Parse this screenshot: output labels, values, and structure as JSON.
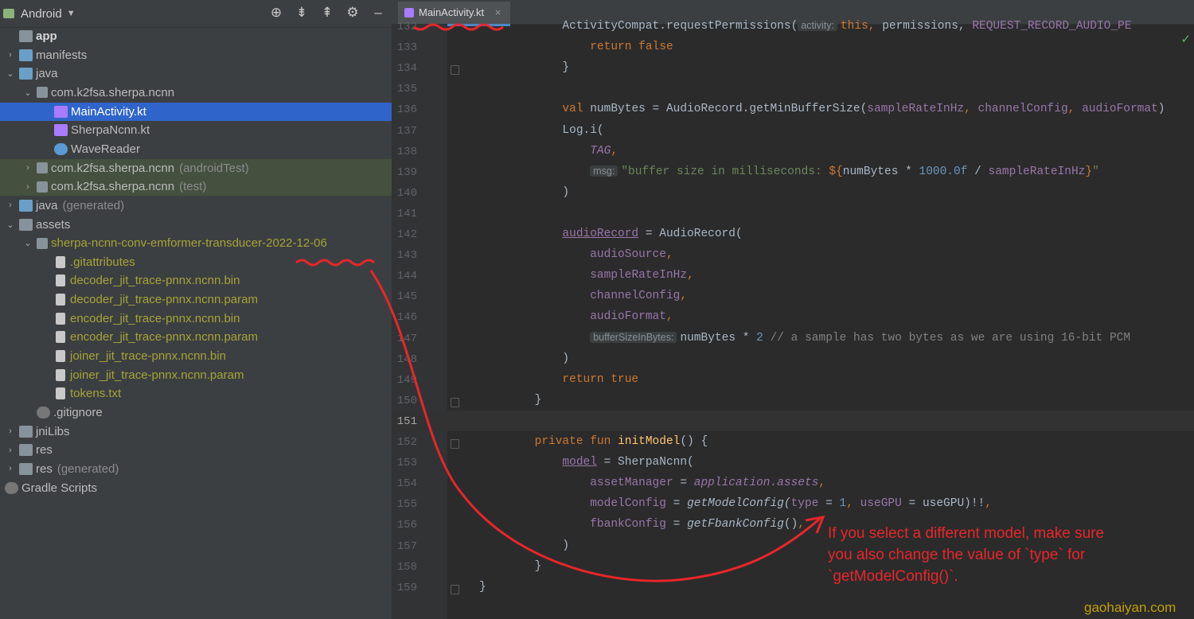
{
  "project": {
    "title": "Android",
    "icons": [
      "target-icon",
      "expand-icon",
      "collapse-icon",
      "gear-icon"
    ],
    "rows": [
      {
        "label": "app",
        "extra": "",
        "kind": "app",
        "indent": 0,
        "arrow": "",
        "style": ""
      },
      {
        "label": "manifests",
        "extra": "",
        "kind": "folder-blue",
        "indent": 0,
        "arrow": "›",
        "style": ""
      },
      {
        "label": "java",
        "extra": "",
        "kind": "folder-blue",
        "indent": 0,
        "arrow": "⌄",
        "style": ""
      },
      {
        "label": "com.k2fsa.sherpa.ncnn",
        "extra": "",
        "kind": "pkg",
        "indent": 1,
        "arrow": "⌄",
        "style": ""
      },
      {
        "label": "MainActivity.kt",
        "extra": "",
        "kind": "kt",
        "indent": 2,
        "arrow": "",
        "style": "sel"
      },
      {
        "label": "SherpaNcnn.kt",
        "extra": "",
        "kind": "kt",
        "indent": 2,
        "arrow": "",
        "style": ""
      },
      {
        "label": "WaveReader",
        "extra": "",
        "kind": "wave",
        "indent": 2,
        "arrow": "",
        "style": ""
      },
      {
        "label": "com.k2fsa.sherpa.ncnn",
        "extra": "(androidTest)",
        "kind": "pkg",
        "indent": 1,
        "arrow": "›",
        "style": "test"
      },
      {
        "label": "com.k2fsa.sherpa.ncnn",
        "extra": "(test)",
        "kind": "pkg",
        "indent": 1,
        "arrow": "›",
        "style": "test"
      },
      {
        "label": "java",
        "extra": "(generated)",
        "kind": "folder-blue",
        "indent": 0,
        "arrow": "›",
        "style": ""
      },
      {
        "label": "assets",
        "extra": "",
        "kind": "folder",
        "indent": 0,
        "arrow": "⌄",
        "style": ""
      },
      {
        "label": "sherpa-ncnn-conv-emformer-transducer-2022-12-06",
        "extra": "",
        "kind": "pkg",
        "indent": 1,
        "arrow": "⌄",
        "style": "olive"
      },
      {
        "label": ".gitattributes",
        "extra": "",
        "kind": "file",
        "indent": 2,
        "arrow": "",
        "style": "olive"
      },
      {
        "label": "decoder_jit_trace-pnnx.ncnn.bin",
        "extra": "",
        "kind": "file",
        "indent": 2,
        "arrow": "",
        "style": "olive"
      },
      {
        "label": "decoder_jit_trace-pnnx.ncnn.param",
        "extra": "",
        "kind": "file",
        "indent": 2,
        "arrow": "",
        "style": "olive"
      },
      {
        "label": "encoder_jit_trace-pnnx.ncnn.bin",
        "extra": "",
        "kind": "file",
        "indent": 2,
        "arrow": "",
        "style": "olive"
      },
      {
        "label": "encoder_jit_trace-pnnx.ncnn.param",
        "extra": "",
        "kind": "file",
        "indent": 2,
        "arrow": "",
        "style": "olive"
      },
      {
        "label": "joiner_jit_trace-pnnx.ncnn.bin",
        "extra": "",
        "kind": "file",
        "indent": 2,
        "arrow": "",
        "style": "olive"
      },
      {
        "label": "joiner_jit_trace-pnnx.ncnn.param",
        "extra": "",
        "kind": "file",
        "indent": 2,
        "arrow": "",
        "style": "olive"
      },
      {
        "label": "tokens.txt",
        "extra": "",
        "kind": "file",
        "indent": 2,
        "arrow": "",
        "style": "olive"
      },
      {
        "label": ".gitignore",
        "extra": "",
        "kind": "gear",
        "indent": 1,
        "arrow": "",
        "style": ""
      },
      {
        "label": "jniLibs",
        "extra": "",
        "kind": "folder",
        "indent": 0,
        "arrow": "›",
        "style": ""
      },
      {
        "label": "res",
        "extra": "",
        "kind": "folder",
        "indent": 0,
        "arrow": "›",
        "style": ""
      },
      {
        "label": "res",
        "extra": "(generated)",
        "kind": "folder",
        "indent": 0,
        "arrow": "›",
        "style": ""
      },
      {
        "label": "Gradle Scripts",
        "extra": "",
        "kind": "gradle",
        "indent": -1,
        "arrow": "",
        "style": ""
      }
    ]
  },
  "editor": {
    "tab_label": "MainActivity.kt",
    "tab_close": "×",
    "current_line": "151",
    "lines": [
      {
        "n": "132",
        "segs": [
          [
            "pad",
            "            "
          ],
          [
            "par",
            "ActivityCompat.requestPermissions("
          ],
          [
            "hint",
            "activity:"
          ],
          [
            "kw",
            "this, "
          ],
          [
            "par",
            "permissions, "
          ],
          [
            "prop",
            "REQUEST_RECORD_AUDIO_PE"
          ]
        ]
      },
      {
        "n": "133",
        "segs": [
          [
            "pad",
            "                "
          ],
          [
            "kw",
            "return false"
          ]
        ]
      },
      {
        "n": "134",
        "segs": [
          [
            "pad",
            "            "
          ],
          [
            "par",
            "}"
          ]
        ]
      },
      {
        "n": "135",
        "segs": []
      },
      {
        "n": "136",
        "segs": [
          [
            "pad",
            "            "
          ],
          [
            "kw",
            "val "
          ],
          [
            "par",
            "numBytes = AudioRecord.getMinBufferSize("
          ],
          [
            "prop",
            "sampleRateInHz"
          ],
          [
            "kw",
            ", "
          ],
          [
            "prop",
            "channelConfig"
          ],
          [
            "kw",
            ", "
          ],
          [
            "prop",
            "audioFormat"
          ],
          [
            "par",
            ")"
          ]
        ]
      },
      {
        "n": "137",
        "segs": [
          [
            "pad",
            "            "
          ],
          [
            "par",
            "Log.i("
          ]
        ]
      },
      {
        "n": "138",
        "segs": [
          [
            "pad",
            "                "
          ],
          [
            "propi",
            "TAG"
          ],
          [
            "kw",
            ","
          ]
        ]
      },
      {
        "n": "139",
        "segs": [
          [
            "pad",
            "                "
          ],
          [
            "hint",
            "msg:"
          ],
          [
            "str",
            "\"buffer size in milliseconds: "
          ],
          [
            "kw",
            "${"
          ],
          [
            "par",
            "numBytes * "
          ],
          [
            "num",
            "1000.0f"
          ],
          [
            "par",
            " / "
          ],
          [
            "prop",
            "sampleRateInHz"
          ],
          [
            "kw",
            "}"
          ],
          [
            "str",
            "\""
          ]
        ]
      },
      {
        "n": "140",
        "segs": [
          [
            "pad",
            "            "
          ],
          [
            "par",
            ")"
          ]
        ]
      },
      {
        "n": "141",
        "segs": []
      },
      {
        "n": "142",
        "segs": [
          [
            "pad",
            "            "
          ],
          [
            "propu",
            "audioRecord"
          ],
          [
            "par",
            " = AudioRecord("
          ]
        ]
      },
      {
        "n": "143",
        "segs": [
          [
            "pad",
            "                "
          ],
          [
            "prop",
            "audioSource"
          ],
          [
            "kw",
            ","
          ]
        ]
      },
      {
        "n": "144",
        "segs": [
          [
            "pad",
            "                "
          ],
          [
            "prop",
            "sampleRateInHz"
          ],
          [
            "kw",
            ","
          ]
        ]
      },
      {
        "n": "145",
        "segs": [
          [
            "pad",
            "                "
          ],
          [
            "prop",
            "channelConfig"
          ],
          [
            "kw",
            ","
          ]
        ]
      },
      {
        "n": "146",
        "segs": [
          [
            "pad",
            "                "
          ],
          [
            "prop",
            "audioFormat"
          ],
          [
            "kw",
            ","
          ]
        ]
      },
      {
        "n": "147",
        "segs": [
          [
            "pad",
            "                "
          ],
          [
            "hint",
            "bufferSizeInBytes:"
          ],
          [
            "par",
            "numBytes * "
          ],
          [
            "num",
            "2"
          ],
          [
            "cm",
            " // a sample has two bytes as we are using 16-bit PCM"
          ]
        ]
      },
      {
        "n": "148",
        "segs": [
          [
            "pad",
            "            "
          ],
          [
            "par",
            ")"
          ]
        ]
      },
      {
        "n": "149",
        "segs": [
          [
            "pad",
            "            "
          ],
          [
            "kw",
            "return true"
          ]
        ]
      },
      {
        "n": "150",
        "segs": [
          [
            "pad",
            "        "
          ],
          [
            "par",
            "}"
          ]
        ]
      },
      {
        "n": "151",
        "segs": []
      },
      {
        "n": "152",
        "segs": [
          [
            "pad",
            "        "
          ],
          [
            "kw",
            "private fun "
          ],
          [
            "fn",
            "initModel"
          ],
          [
            "par",
            "() {"
          ]
        ]
      },
      {
        "n": "153",
        "segs": [
          [
            "pad",
            "            "
          ],
          [
            "propu",
            "model"
          ],
          [
            "par",
            " = SherpaNcnn("
          ]
        ]
      },
      {
        "n": "154",
        "segs": [
          [
            "pad",
            "                "
          ],
          [
            "prop",
            "assetManager"
          ],
          [
            "par",
            " = "
          ],
          [
            "propi",
            "application.assets"
          ],
          [
            "kw",
            ","
          ]
        ]
      },
      {
        "n": "155",
        "segs": [
          [
            "pad",
            "                "
          ],
          [
            "prop",
            "modelConfig"
          ],
          [
            "par",
            " = "
          ],
          [
            "ital",
            "getModelConfig("
          ],
          [
            "prop",
            "type"
          ],
          [
            "par",
            " = "
          ],
          [
            "num",
            "1"
          ],
          [
            "kw",
            ", "
          ],
          [
            "prop",
            "useGPU"
          ],
          [
            "par",
            " = useGPU)!!"
          ],
          [
            "kw",
            ","
          ]
        ]
      },
      {
        "n": "156",
        "segs": [
          [
            "pad",
            "                "
          ],
          [
            "prop",
            "fbankConfig"
          ],
          [
            "par",
            " = "
          ],
          [
            "ital",
            "getFbankConfig"
          ],
          [
            "par",
            "()"
          ],
          [
            "kw",
            ","
          ]
        ]
      },
      {
        "n": "157",
        "segs": [
          [
            "pad",
            "            "
          ],
          [
            "par",
            ")"
          ]
        ]
      },
      {
        "n": "158",
        "segs": [
          [
            "pad",
            "        "
          ],
          [
            "par",
            "}"
          ]
        ]
      },
      {
        "n": "159",
        "segs": [
          [
            "par",
            "}"
          ]
        ]
      }
    ]
  },
  "annotation": {
    "lines": [
      "If you select a different model, make sure",
      "you also change the value of `type` for",
      "`getModelConfig()`."
    ],
    "color": "#e8262a"
  },
  "watermark": "gaohaiyan.com"
}
